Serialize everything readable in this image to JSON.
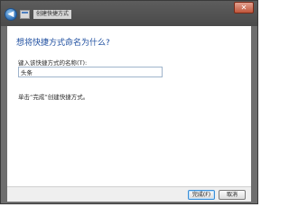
{
  "window": {
    "title": "创建快捷方式",
    "close_label": "✕"
  },
  "nav": {
    "back_glyph": "◀"
  },
  "dialog": {
    "heading": "想将快捷方式命名为什么?",
    "field_label": "键入该快捷方式的名称(T):",
    "name_value": "头条",
    "hint": "单击“完成”创建快捷方式。"
  },
  "footer": {
    "finish_label": "完成(F)",
    "cancel_label": "取消"
  }
}
